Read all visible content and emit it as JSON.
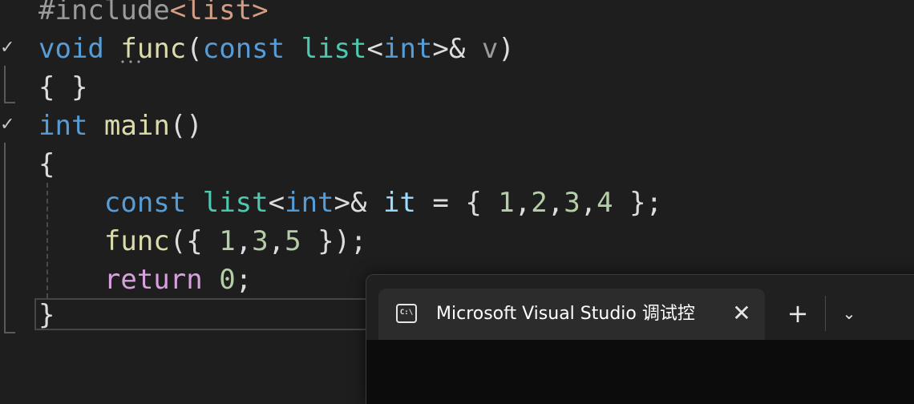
{
  "colors": {
    "keyword": "#569cd6",
    "control": "#d8a0df",
    "type": "#4ec9b0",
    "function": "#dcdcaa",
    "number": "#b5cea8",
    "string": "#d69d85",
    "preproc": "#9b9b9b",
    "variable": "#9cdcfe",
    "param": "#9a9a9a",
    "plain": "#dcdcdc",
    "background": "#1e1e1e"
  },
  "code": {
    "line1": [
      {
        "t": "#include",
        "c": "preproc"
      },
      {
        "t": "<list>",
        "c": "string"
      }
    ],
    "line2": [
      {
        "t": "void",
        "c": "keyword"
      },
      {
        "t": " ",
        "c": "plain"
      },
      {
        "t": "func",
        "c": "function"
      },
      {
        "t": "(",
        "c": "plain"
      },
      {
        "t": "const",
        "c": "keyword"
      },
      {
        "t": " ",
        "c": "plain"
      },
      {
        "t": "list",
        "c": "type"
      },
      {
        "t": "<",
        "c": "plain"
      },
      {
        "t": "int",
        "c": "keyword"
      },
      {
        "t": ">& ",
        "c": "plain"
      },
      {
        "t": "v",
        "c": "param"
      },
      {
        "t": ")",
        "c": "plain"
      }
    ],
    "line3": [
      {
        "t": "{ }",
        "c": "plain"
      }
    ],
    "line4": [
      {
        "t": "int",
        "c": "keyword"
      },
      {
        "t": " ",
        "c": "plain"
      },
      {
        "t": "main",
        "c": "function"
      },
      {
        "t": "()",
        "c": "plain"
      }
    ],
    "line5": [
      {
        "t": "{",
        "c": "plain"
      }
    ],
    "line6": [
      {
        "t": "    ",
        "c": "plain"
      },
      {
        "t": "const",
        "c": "keyword"
      },
      {
        "t": " ",
        "c": "plain"
      },
      {
        "t": "list",
        "c": "type"
      },
      {
        "t": "<",
        "c": "plain"
      },
      {
        "t": "int",
        "c": "keyword"
      },
      {
        "t": ">& ",
        "c": "plain"
      },
      {
        "t": "it",
        "c": "variable"
      },
      {
        "t": " = { ",
        "c": "plain"
      },
      {
        "t": "1",
        "c": "number"
      },
      {
        "t": ",",
        "c": "plain"
      },
      {
        "t": "2",
        "c": "number"
      },
      {
        "t": ",",
        "c": "plain"
      },
      {
        "t": "3",
        "c": "number"
      },
      {
        "t": ",",
        "c": "plain"
      },
      {
        "t": "4",
        "c": "number"
      },
      {
        "t": " };",
        "c": "plain"
      }
    ],
    "line7": [
      {
        "t": "    ",
        "c": "plain"
      },
      {
        "t": "func",
        "c": "function"
      },
      {
        "t": "({ ",
        "c": "plain"
      },
      {
        "t": "1",
        "c": "number"
      },
      {
        "t": ",",
        "c": "plain"
      },
      {
        "t": "3",
        "c": "number"
      },
      {
        "t": ",",
        "c": "plain"
      },
      {
        "t": "5",
        "c": "number"
      },
      {
        "t": " });",
        "c": "plain"
      }
    ],
    "line8": [
      {
        "t": "    ",
        "c": "plain"
      },
      {
        "t": "return",
        "c": "control"
      },
      {
        "t": " ",
        "c": "plain"
      },
      {
        "t": "0",
        "c": "number"
      },
      {
        "t": ";",
        "c": "plain"
      }
    ],
    "line9": [
      {
        "t": "}",
        "c": "plain"
      }
    ]
  },
  "gutter": {
    "check_glyph": "✓"
  },
  "terminal": {
    "tab_icon_text": "C:\\",
    "tab_title": "Microsoft Visual Studio 调试控",
    "close_glyph": "✕",
    "new_tab_glyph": "+",
    "dropdown_glyph": "⌄"
  }
}
